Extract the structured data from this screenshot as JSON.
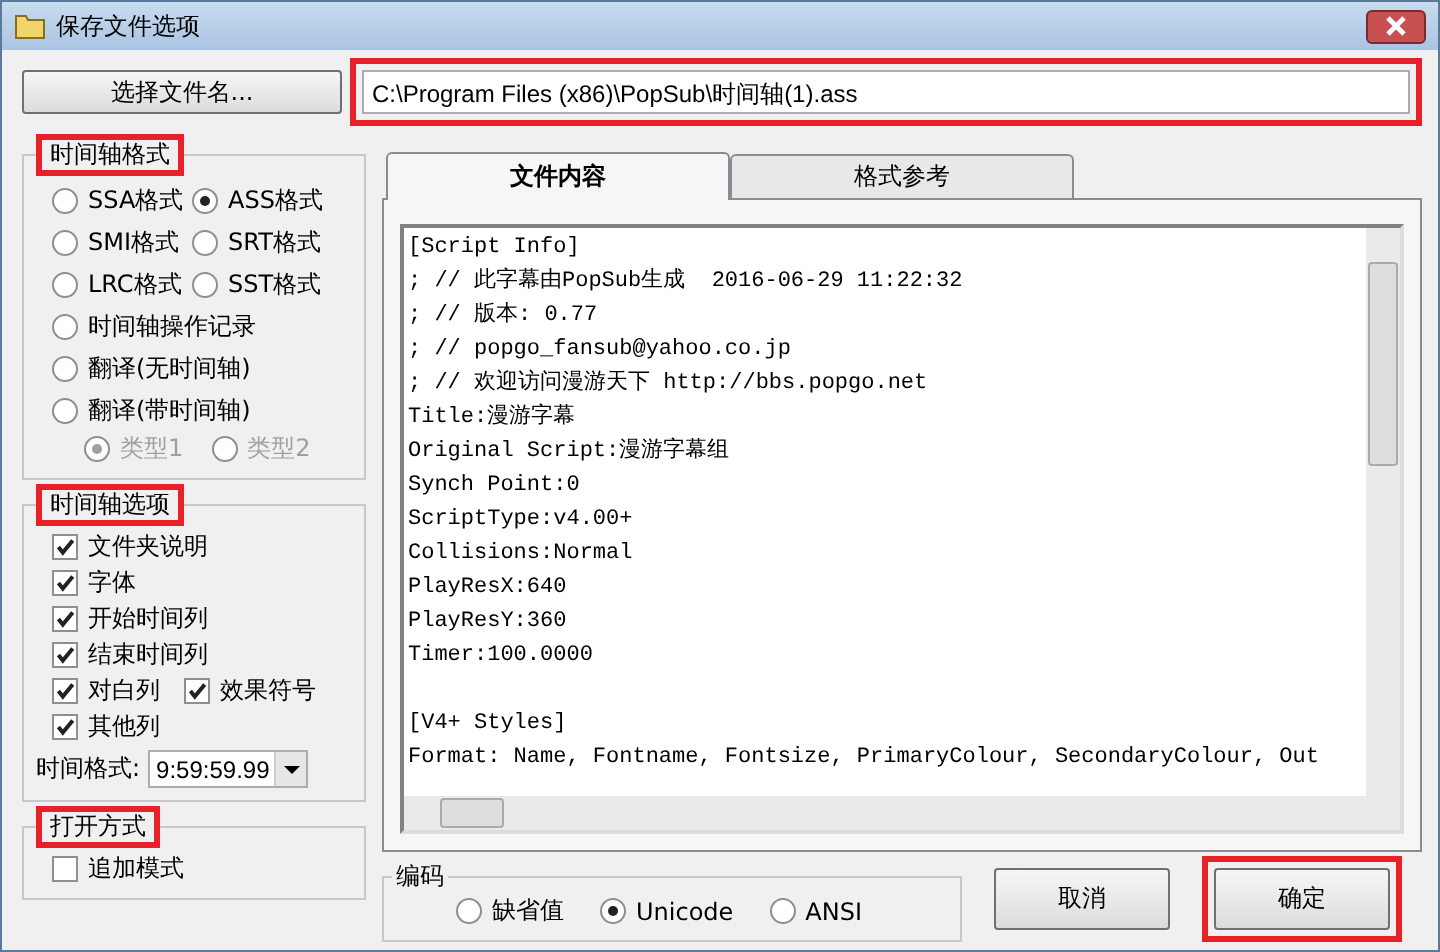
{
  "window": {
    "title": "保存文件选项"
  },
  "file": {
    "button": "选择文件名...",
    "path": "C:\\Program Files (x86)\\PopSub\\时间轴(1).ass",
    "highlighted": true
  },
  "format_group": {
    "title": "时间轴格式",
    "highlighted": true,
    "options": [
      {
        "label": "SSA格式",
        "kind": "short",
        "selected": false
      },
      {
        "label": "ASS格式",
        "kind": "short",
        "selected": true
      },
      {
        "label": "SMI格式",
        "kind": "short",
        "selected": false
      },
      {
        "label": "SRT格式",
        "kind": "short",
        "selected": false
      },
      {
        "label": "LRC格式",
        "kind": "short",
        "selected": false
      },
      {
        "label": "SST格式",
        "kind": "short",
        "selected": false
      },
      {
        "label": "时间轴操作记录",
        "kind": "long",
        "selected": false
      },
      {
        "label": "翻译(无时间轴)",
        "kind": "long",
        "selected": false
      },
      {
        "label": "翻译(带时间轴)",
        "kind": "long",
        "selected": false
      }
    ],
    "sub_options": [
      {
        "label": "类型1",
        "selected": true,
        "disabled": true
      },
      {
        "label": "类型2",
        "selected": false,
        "disabled": true
      }
    ]
  },
  "options_group": {
    "title": "时间轴选项",
    "highlighted": true,
    "checkboxes": [
      {
        "label": "文件夹说明",
        "kind": "long",
        "checked": true
      },
      {
        "label": "字体",
        "kind": "long",
        "checked": true
      },
      {
        "label": "开始时间列",
        "kind": "long",
        "checked": true
      },
      {
        "label": "结束时间列",
        "kind": "long",
        "checked": true
      },
      {
        "label": "对白列",
        "kind": "short",
        "checked": true
      },
      {
        "label": "效果符号",
        "kind": "short",
        "checked": true
      },
      {
        "label": "其他列",
        "kind": "long",
        "checked": true
      }
    ],
    "time_format": {
      "label": "时间格式:",
      "value": "9:59:59.99"
    }
  },
  "open_group": {
    "title": "打开方式",
    "highlighted": true,
    "checkboxes": [
      {
        "label": "追加模式",
        "checked": false
      }
    ]
  },
  "tabs": [
    {
      "label": "文件内容",
      "selected": true
    },
    {
      "label": "格式参考",
      "selected": false
    }
  ],
  "content": {
    "blocks": [
      {
        "lines": [
          "[Script Info]",
          "; // 此字幕由PopSub生成  2016-06-29 11:22:32",
          "; // 版本: 0.77",
          "; // popgo_fansub@yahoo.co.jp",
          "; // 欢迎访问漫游天下 http://bbs.popgo.net",
          "Title:漫游字幕",
          "Original Script:漫游字幕组",
          "Synch Point:0",
          "ScriptType:v4.00+",
          "Collisions:Normal",
          "PlayResX:640",
          "PlayResY:360",
          "Timer:100.0000"
        ]
      },
      {
        "lines": [
          "[V4+ Styles]",
          "Format: Name, Fontname, Fontsize, PrimaryColour, SecondaryColour, Out"
        ]
      }
    ]
  },
  "encoding": {
    "title": "编码",
    "options": [
      {
        "label": "缺省值",
        "selected": false
      },
      {
        "label": "Unicode",
        "selected": true
      },
      {
        "label": "ANSI",
        "selected": false
      }
    ]
  },
  "buttons": [
    {
      "label": "取消",
      "highlighted": false
    },
    {
      "label": "确定",
      "highlighted": true
    }
  ]
}
